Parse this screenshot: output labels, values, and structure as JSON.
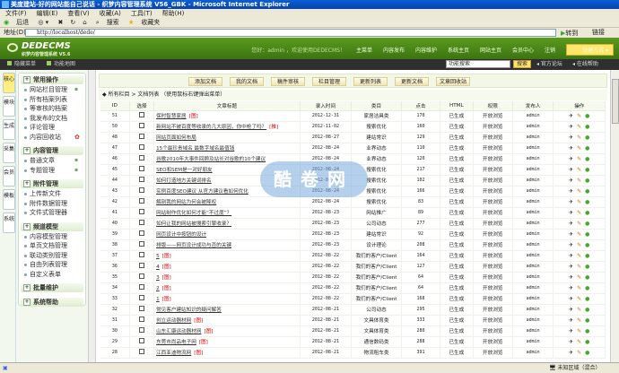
{
  "window": {
    "title": "美度建站-好的网站能自己说话 - 织梦内容管理系统 V56_GBK - Microsoft Internet Explorer"
  },
  "menu": [
    "文件(F)",
    "编辑(E)",
    "查看(V)",
    "收藏(A)",
    "工具(T)",
    "帮助(H)"
  ],
  "toolbar": {
    "back": "后退",
    "search": "搜索",
    "favorites": "收藏夹"
  },
  "address": {
    "label": "地址(D)",
    "url": "http://localhost/dede/",
    "go": "转到",
    "links": "链接"
  },
  "header": {
    "logo": "DEDECMS",
    "logo_sub": "织梦内容管理系统 V5.6",
    "greeting": "您好：admin ，欢迎使用DEDECMS！",
    "nav": [
      "主菜单",
      "内容发布",
      "内容维护",
      "系统主页",
      "网站主页",
      "会员中心",
      "注销"
    ],
    "quick": "快捷方式"
  },
  "darkbar": {
    "hide_menu": "隐藏菜单",
    "func_map": "功能地图",
    "search_value": "功能搜索",
    "search_btn": "搜索",
    "forum": "官方论坛",
    "help": "在线帮助"
  },
  "vtabs": [
    "核心",
    "模块",
    "生成",
    "采集",
    "会员",
    "模板",
    "系统"
  ],
  "sidebar": [
    {
      "title": "常用操作",
      "items": [
        "网站栏目管理",
        "所有档案列表",
        "等审核的档案",
        "我发布的文档",
        "评论管理",
        "内容回收站"
      ]
    },
    {
      "title": "内容管理",
      "items": [
        "普通文章",
        "专题管理"
      ]
    },
    {
      "title": "附件管理",
      "items": [
        "上传新文件",
        "附件数据管理",
        "文件式管理器"
      ]
    },
    {
      "title": "频道模型",
      "items": [
        "内容模型管理",
        "单页文档管理",
        "联动类别管理",
        "自由列表管理",
        "自定义表单"
      ]
    },
    {
      "title": "批量维护",
      "items": []
    },
    {
      "title": "系统帮助",
      "items": []
    }
  ],
  "buttons": [
    "添加文档",
    "我的文档",
    "稿件审核",
    "栏目管理",
    "更新列表",
    "更新文档",
    "文章回收站"
  ],
  "breadcrumb": "所有栏目 > 文档列表   （使用鼠标右键弹出菜单）",
  "columns": [
    "ID",
    "选择",
    "文章标题",
    "录入时间",
    "类目",
    "点击",
    "HTML",
    "权限",
    "发布人",
    "操作"
  ],
  "rows": [
    [
      "51",
      "保时智慧家居",
      "图",
      "2012-12-31",
      "家居洁具类",
      "170"
    ],
    [
      "50",
      "新网站不被百度等收录的几大原因，你中枪了吗？",
      "推",
      "2012-11-02",
      "搜索优化",
      "160"
    ],
    [
      "48",
      "网站页面如何布局",
      "",
      "2012-08-27",
      "建站常识",
      "129"
    ],
    [
      "47",
      "15个最珍贵域名 最数字域名最值钱",
      "",
      "2012-08-24",
      "业界动态",
      "110"
    ],
    [
      "46",
      "谷歌2010年大事件回顾及站长对谷歌的10个建议",
      "",
      "2012-08-24",
      "业界动态",
      "120"
    ],
    [
      "45",
      "SEO和SEM是一对好朋友",
      "",
      "2012-08-24",
      "搜索优化",
      "217"
    ],
    [
      "44",
      "如何打造地方关键词排名",
      "",
      "2012-08-24",
      "搜索优化",
      "102"
    ],
    [
      "43",
      "实例百度SEO建议 从官方建议看如何优化",
      "",
      "2012-08-24",
      "搜索优化",
      "166"
    ],
    [
      "42",
      "解剖我的网站为何会被降权",
      "",
      "2012-08-24",
      "搜索优化",
      "83"
    ],
    [
      "41",
      "网站制作优化如何才能“不过度”？",
      "",
      "2012-08-23",
      "网站推广",
      "89"
    ],
    [
      "40",
      "如何让我的网站被搜索引擎收录？",
      "",
      "2012-08-23",
      "公司动态",
      "277"
    ],
    [
      "39",
      "网页设计中按钮的设计",
      "",
      "2012-08-23",
      "建站常识",
      "92"
    ],
    [
      "38",
      "排版——网页设计成功与否的关键",
      "",
      "2012-08-23",
      "设计理论",
      "208"
    ],
    [
      "37",
      "5",
      "图",
      "2012-08-22",
      "我们的客户/Client",
      "164"
    ],
    [
      "36",
      "4",
      "图",
      "2012-08-22",
      "我们的客户/Client",
      "127"
    ],
    [
      "35",
      "3",
      "图",
      "2012-08-22",
      "我们的客户/Client",
      "64"
    ],
    [
      "34",
      "2",
      "图",
      "2012-08-22",
      "我们的客户/Client",
      "64"
    ],
    [
      "33",
      "1",
      "图",
      "2012-08-22",
      "我们的客户/Client",
      "168"
    ],
    [
      "32",
      "常见客户建站知识的疑问解答",
      "",
      "2012-08-21",
      "公司动态",
      "295"
    ],
    [
      "31",
      "创立运动器材网",
      "图",
      "2012-08-21",
      "文具体育类",
      "333"
    ],
    [
      "30",
      "山东汇康运动器材网",
      "图",
      "2012-08-21",
      "文具体育类",
      "280"
    ],
    [
      "29",
      "东莞市尚品电子网",
      "图",
      "2012-08-21",
      "通信数码类",
      "288"
    ],
    [
      "28",
      "江西亚迪物流网",
      "图",
      "2012-08-21",
      "物流租车类",
      "391"
    ]
  ],
  "row_common": {
    "html": "已生成",
    "perm": "开放浏览",
    "author": "admin"
  },
  "watermark": "酷卷网",
  "status": {
    "zone": "未知区域（混合）"
  }
}
